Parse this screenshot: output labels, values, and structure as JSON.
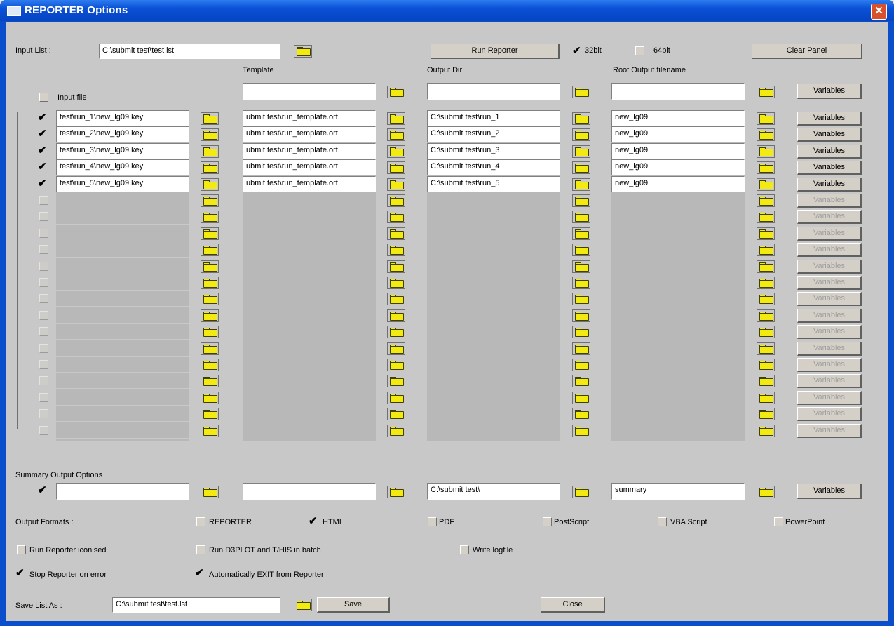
{
  "window": {
    "title": "REPORTER Options",
    "close": "✕"
  },
  "top": {
    "input_list_label": "Input List :",
    "input_list_value": "C:\\submit test\\test.lst",
    "run_reporter": "Run Reporter",
    "opt_32bit": "32bit",
    "opt_64bit": "64bit",
    "clear_panel": "Clear Panel"
  },
  "headers": {
    "template": "Template",
    "output_dir": "Output Dir",
    "root_output": "Root Output filename",
    "input_file": "Input file",
    "variables": "Variables"
  },
  "rows": [
    {
      "input": "test\\run_1\\new_lg09.key",
      "template": "ubmit test\\run_template.ort",
      "outdir": "C:\\submit test\\run_1",
      "root": "new_lg09"
    },
    {
      "input": "test\\run_2\\new_lg09.key",
      "template": "ubmit test\\run_template.ort",
      "outdir": "C:\\submit test\\run_2",
      "root": "new_lg09"
    },
    {
      "input": "test\\run_3\\new_lg09.key",
      "template": "ubmit test\\run_template.ort",
      "outdir": "C:\\submit test\\run_3",
      "root": "new_lg09"
    },
    {
      "input": "test\\run_4\\new_lg09.key",
      "template": "ubmit test\\run_template.ort",
      "outdir": "C:\\submit test\\run_4",
      "root": "new_lg09"
    },
    {
      "input": "test\\run_5\\new_lg09.key",
      "template": "ubmit test\\run_template.ort",
      "outdir": "C:\\submit test\\run_5",
      "root": "new_lg09"
    }
  ],
  "summary": {
    "label": "Summary Output Options",
    "outdir": "C:\\submit test\\",
    "root": "summary"
  },
  "formats": {
    "label": "Output Formats :",
    "reporter": "REPORTER",
    "html": "HTML",
    "pdf": "PDF",
    "postscript": "PostScript",
    "vba": "VBA Script",
    "powerpoint": "PowerPoint"
  },
  "options": {
    "iconised": "Run Reporter iconised",
    "batch": "Run D3PLOT and T/HIS in batch",
    "logfile": "Write logfile",
    "stop_on_error": "Stop Reporter on error",
    "auto_exit": "Automatically EXIT from Reporter"
  },
  "bottom": {
    "save_label": "Save List As :",
    "save_value": "C:\\submit test\\test.lst",
    "save_btn": "Save",
    "close_btn": "Close"
  },
  "check": "✔"
}
